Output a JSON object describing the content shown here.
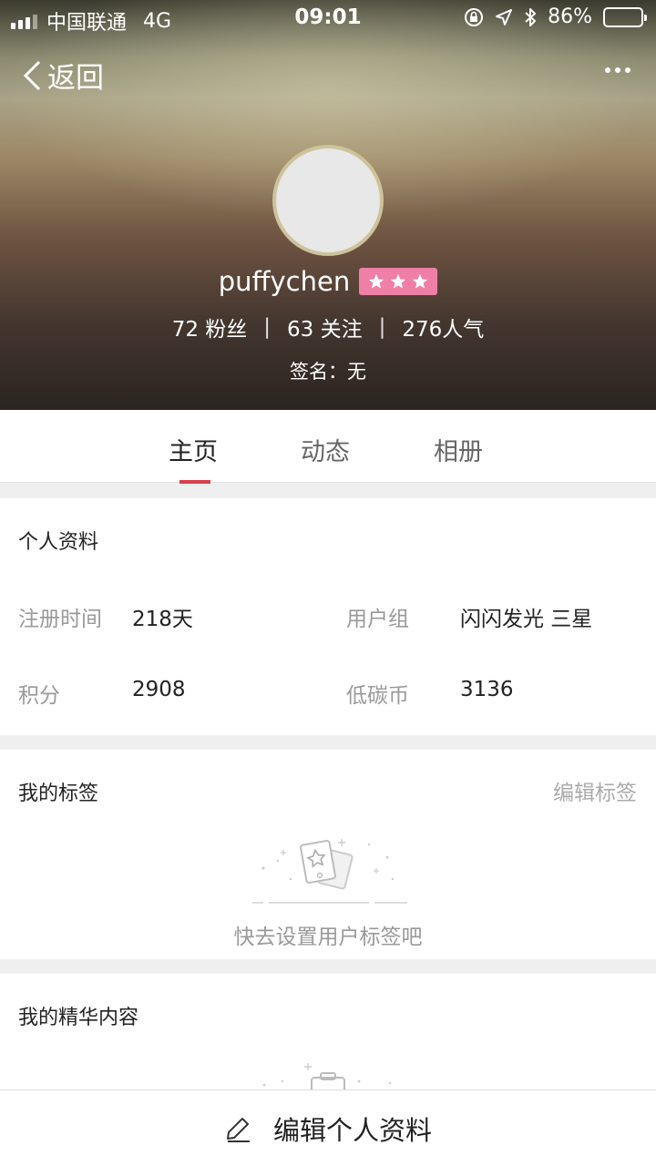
{
  "status_bar": {
    "carrier": "中国联通",
    "network": "4G",
    "time": "09:01",
    "battery_text": "86%",
    "battery_level": 0.86
  },
  "nav": {
    "back_label": "返回"
  },
  "profile": {
    "username": "puffychen",
    "stars": 3,
    "followers": "72 粉丝",
    "following": "63 关注",
    "popularity": "276人气",
    "signature": "签名：无"
  },
  "tabs": [
    {
      "label": "主页",
      "active": true
    },
    {
      "label": "动态",
      "active": false
    },
    {
      "label": "相册",
      "active": false
    }
  ],
  "personal_info": {
    "title": "个人资料",
    "register_time_label": "注册时间",
    "register_time_value": "218天",
    "user_group_label": "用户组",
    "user_group_value": "闪闪发光 三星",
    "points_label": "积分",
    "points_value": "2908",
    "coins_label": "低碳币",
    "coins_value": "3136"
  },
  "tags": {
    "title": "我的标签",
    "edit_label": "编辑标签",
    "empty_text": "快去设置用户标签吧"
  },
  "featured": {
    "title": "我的精华内容"
  },
  "bottom_bar": {
    "label": "编辑个人资料"
  },
  "colors": {
    "accent": "#d9414b",
    "badge": "#ef7fa7"
  }
}
